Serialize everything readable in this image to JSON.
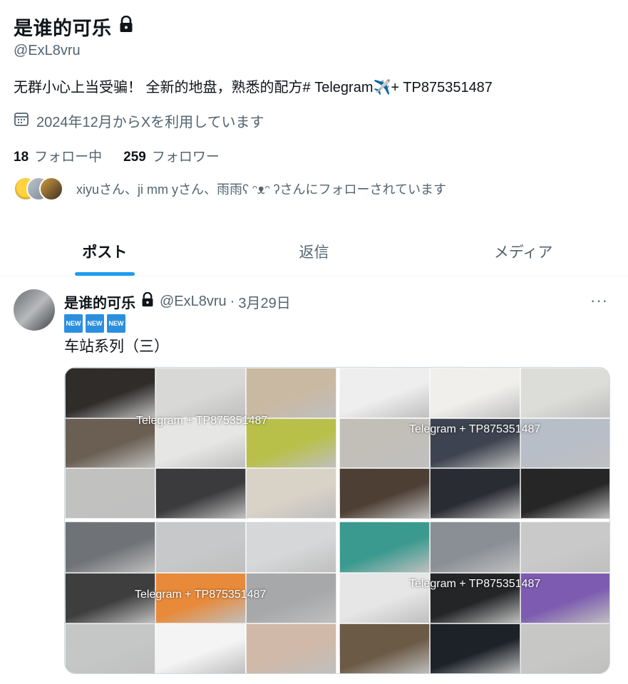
{
  "profile": {
    "name": "是谁的可乐",
    "handle": "@ExL8vru",
    "bio": "无群小心上当受骗！ 全新的地盘，熟悉的配方# Telegram✈️+ TP875351487",
    "joined": "2024年12月からXを利用しています",
    "following_count": "18",
    "following_label": "フォロー中",
    "followers_count": "259",
    "followers_label": "フォロワー",
    "followed_by": "xiyuさん、ji mm yさん、雨雨ʕ ᵔᴥᵔ ʔさんにフォローされています"
  },
  "tabs": [
    {
      "label": "ポスト",
      "active": true
    },
    {
      "label": "返信",
      "active": false
    },
    {
      "label": "メディア",
      "active": false
    }
  ],
  "post": {
    "name": "是谁的可乐",
    "handle": "@ExL8vru",
    "dot": "·",
    "date": "3月29日",
    "more": "···",
    "badges": [
      "NEW",
      "NEW",
      "NEW"
    ],
    "text": "车站系列（三）",
    "watermark": "Telegram + TP875351487",
    "images": [
      {
        "rows": 3,
        "colors": [
          "#2f2c2a",
          "#d8d8d6",
          "#c9b9a2",
          "#6a5f52",
          "#e6e6e4",
          "#b9c04a",
          "#c1c1c0",
          "#3b3b3d",
          "#d9d2c7",
          "#efefec",
          "#c7c2bb",
          "#e2e0dc"
        ]
      },
      {
        "rows": 3,
        "colors": [
          "#eeeeee",
          "#f0efec",
          "#dcdcd8",
          "#c2bfb9",
          "#3d4350",
          "#b8bec8",
          "#4e3f34",
          "#2a2c33",
          "#262626",
          "#f3f3f3",
          "#e8d9c5",
          "#d7cfc4"
        ]
      },
      {
        "rows": 3,
        "colors": [
          "#6f7276",
          "#c7c8c9",
          "#d6d7d8",
          "#3e3e3e",
          "#e88a3a",
          "#a7a8aa",
          "#c5c6c6",
          "#f4f4f4",
          "#d0b9a8",
          "#e2e2e2",
          "#8f3c34",
          "#d9d9d9"
        ]
      },
      {
        "rows": 3,
        "colors": [
          "#3b9a8f",
          "#8a8f95",
          "#c9c9c9",
          "#e6e6e6",
          "#232526",
          "#7c5bb0",
          "#6b5a45",
          "#1d2228",
          "#c7c7c5",
          "#b19170",
          "#2c3644",
          "#2a2a2a"
        ]
      }
    ]
  },
  "colors": {
    "accent": "#1d9bf0",
    "text": "#0f1419",
    "secondary": "#536471"
  },
  "icons": [
    "lock-icon",
    "calendar-icon",
    "more-icon"
  ]
}
